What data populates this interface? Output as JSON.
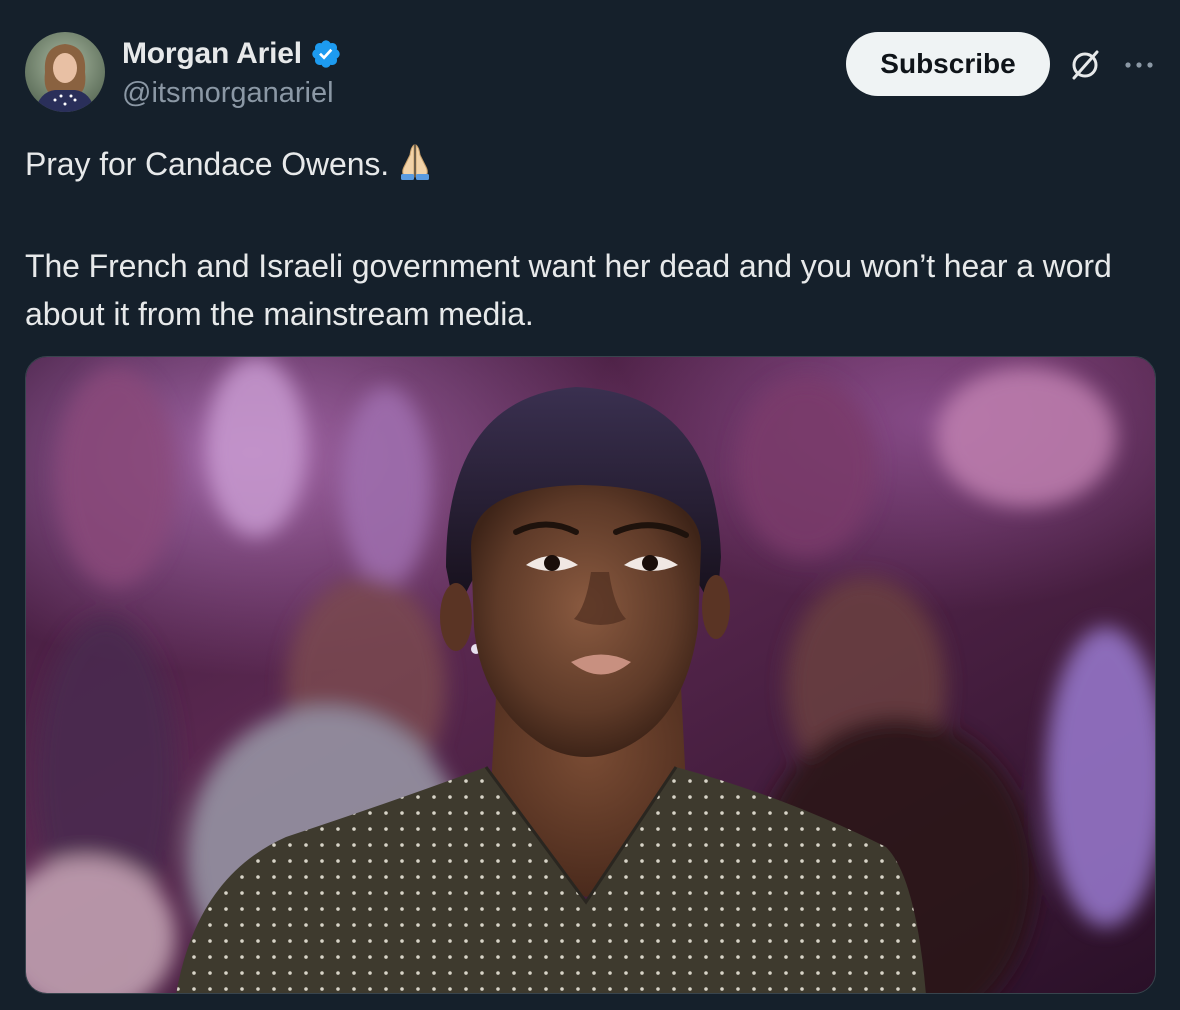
{
  "author": {
    "display_name": "Morgan Ariel",
    "handle": "@itsmorganariel",
    "verified": true,
    "avatar_icon": "profile-photo"
  },
  "actions": {
    "subscribe_label": "Subscribe",
    "grok_icon": "grok-icon",
    "more_icon": "more-horizontal-icon"
  },
  "tweet": {
    "line1": "Pray for Candace Owens.",
    "emoji": "🙏",
    "line2": "The French and Israeli government want her dead and you won’t hear a word about it from the mainstream media."
  },
  "media": {
    "type": "photo",
    "description_icon": "photo-woman-in-polka-dot-top"
  },
  "colors": {
    "background": "#15202b",
    "text": "#e7e9ea",
    "secondary_text": "#8b98a5",
    "verified_blue": "#1d9bf0",
    "button_bg": "#eff3f4"
  }
}
